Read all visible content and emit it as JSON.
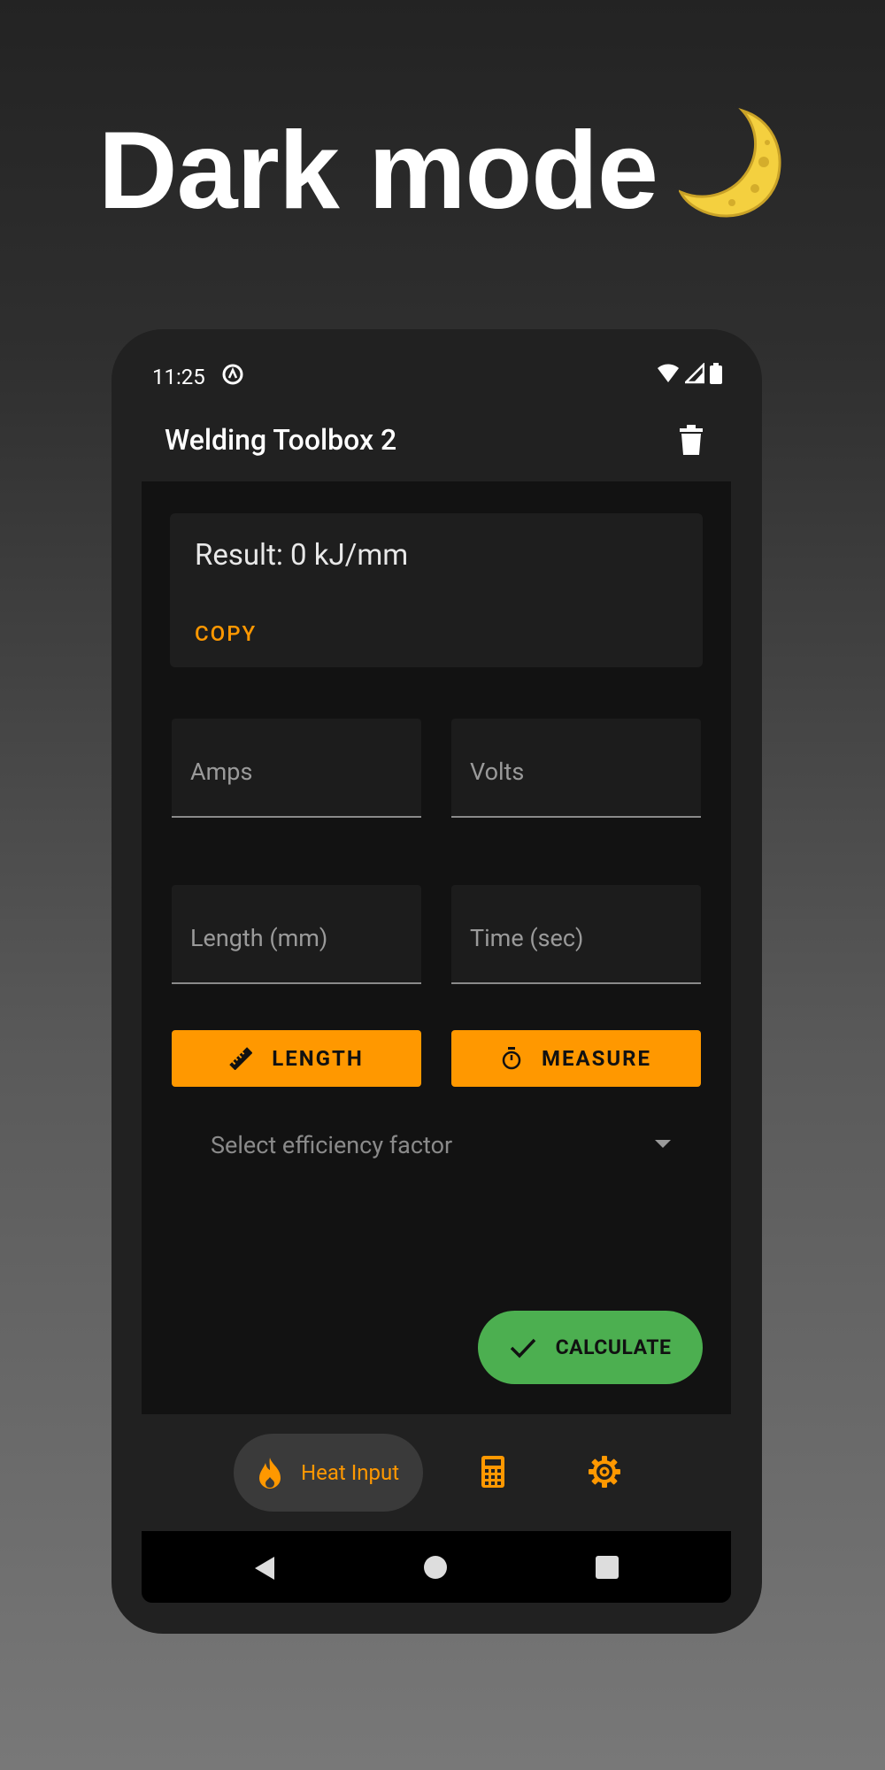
{
  "headline": {
    "text": "Dark mode"
  },
  "statusbar": {
    "time": "11:25"
  },
  "appbar": {
    "title": "Welding Toolbox 2"
  },
  "result_card": {
    "result": "Result: 0 kJ/mm",
    "copy_label": "COPY"
  },
  "fields": {
    "amps": "Amps",
    "volts": "Volts",
    "length": "Length (mm)",
    "time": "Time (sec)"
  },
  "buttons": {
    "length": "LENGTH",
    "measure": "MEASURE",
    "calculate": "CALCULATE"
  },
  "efficiency": {
    "placeholder": "Select efficiency factor"
  },
  "bottom_nav": {
    "active_label": "Heat Input"
  },
  "colors": {
    "accent": "#ff9800",
    "fab": "#4caf50",
    "surface": "#212121",
    "background": "#121212"
  }
}
